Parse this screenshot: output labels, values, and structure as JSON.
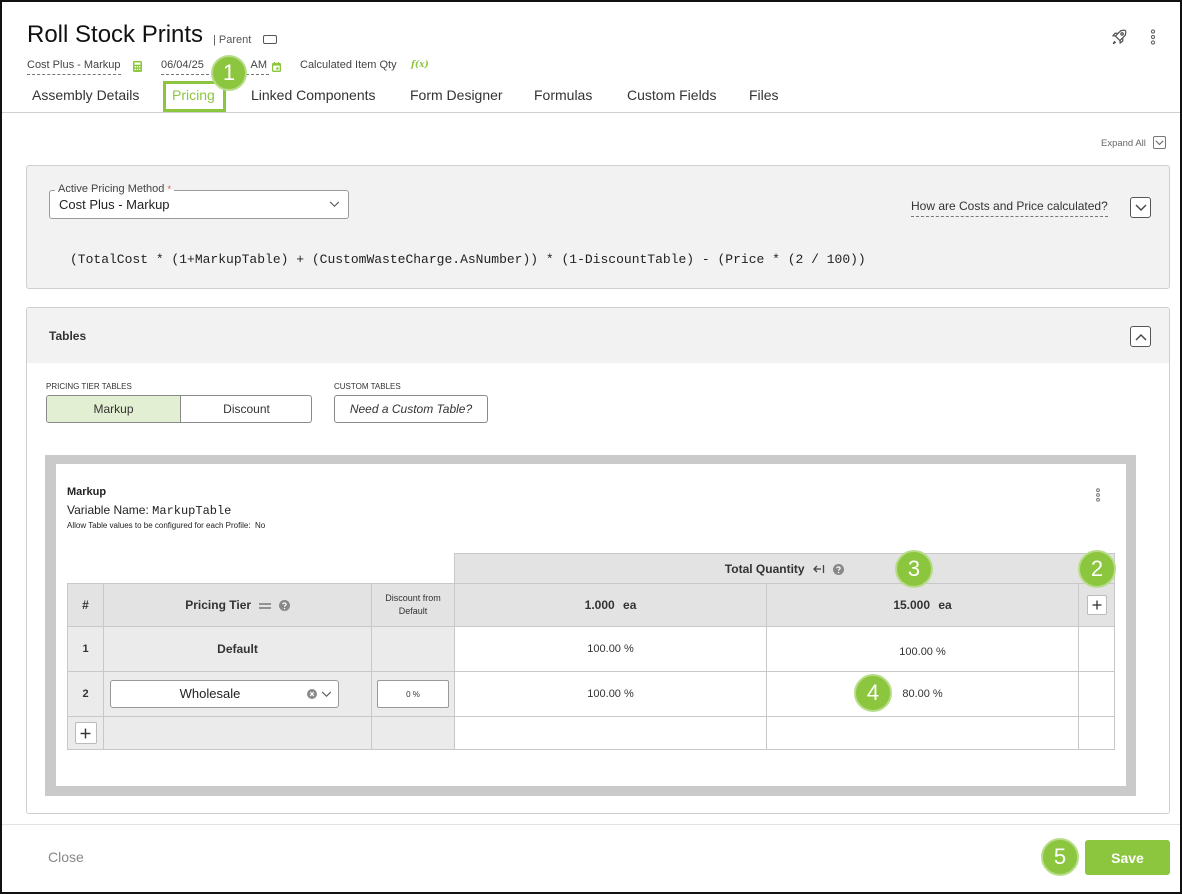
{
  "colors": {
    "accent": "#8cc63f",
    "accent_light": "#e3efd2",
    "required": "#d9534f",
    "text": "#222222",
    "muted": "#888888"
  },
  "header": {
    "title": "Roll Stock Prints",
    "parent_label": "| Parent",
    "parent_icon": "toggle-icon",
    "action_icons": [
      "rocket-icon",
      "more-vertical-icon"
    ],
    "meta": {
      "pricing_method": "Cost Plus - Markup",
      "pricing_method_icon": "calculator-icon",
      "date": "06/04/25",
      "time": "AM",
      "date_icon": "calendar-icon",
      "calc_qty_label": "Calculated Item Qty",
      "calc_qty_icon": "function-icon",
      "calc_qty_icon_text": "f(x)"
    }
  },
  "tabs": {
    "items": [
      {
        "label": "Assembly Details",
        "active": false
      },
      {
        "label": "Pricing",
        "active": true
      },
      {
        "label": "Linked Components",
        "active": false
      },
      {
        "label": "Form Designer",
        "active": false
      },
      {
        "label": "Formulas",
        "active": false
      },
      {
        "label": "Custom Fields",
        "active": false
      },
      {
        "label": "Files",
        "active": false
      }
    ]
  },
  "expand_all": {
    "label": "Expand All",
    "icon": "chevron-down-icon"
  },
  "pricing_method_panel": {
    "field_label": "Active Pricing Method",
    "required_mark": "*",
    "value": "Cost Plus - Markup",
    "help_link": "How are Costs and Price calculated?",
    "toggle_icon": "chevron-down-icon",
    "formula": "(TotalCost * (1+MarkupTable) + (CustomWasteCharge.AsNumber)) * (1-DiscountTable) - (Price * (2 / 100))"
  },
  "tables_panel": {
    "title": "Tables",
    "toggle_icon": "chevron-up-icon",
    "pricing_tier_label": "PRICING TIER TABLES",
    "segments": [
      {
        "label": "Markup",
        "active": true
      },
      {
        "label": "Discount",
        "active": false
      }
    ],
    "custom_tables_label": "CUSTOM TABLES",
    "custom_table_button": "Need a Custom Table?",
    "table": {
      "name": "Markup",
      "variable_label": "Variable Name:",
      "variable_value": "MarkupTable",
      "profile_label": "Allow Table values to be configured for each Profile:",
      "profile_value": "No",
      "group_header": "Total Quantity",
      "columns": {
        "number": "#",
        "tier": "Pricing Tier",
        "discount": "Discount from Default",
        "quantities": [
          "1.000 ea",
          "15.000 ea"
        ]
      },
      "rows": [
        {
          "number": "1",
          "tier": "Default",
          "discount": "",
          "values": [
            "100.00 %",
            "100.00 %"
          ]
        },
        {
          "number": "2",
          "tier": "Wholesale",
          "discount": "0 %",
          "values": [
            "100.00 %",
            "80.00 %"
          ]
        }
      ]
    }
  },
  "footer": {
    "close_label": "Close",
    "save_label": "Save"
  },
  "callouts": [
    "1",
    "2",
    "3",
    "4",
    "5"
  ]
}
